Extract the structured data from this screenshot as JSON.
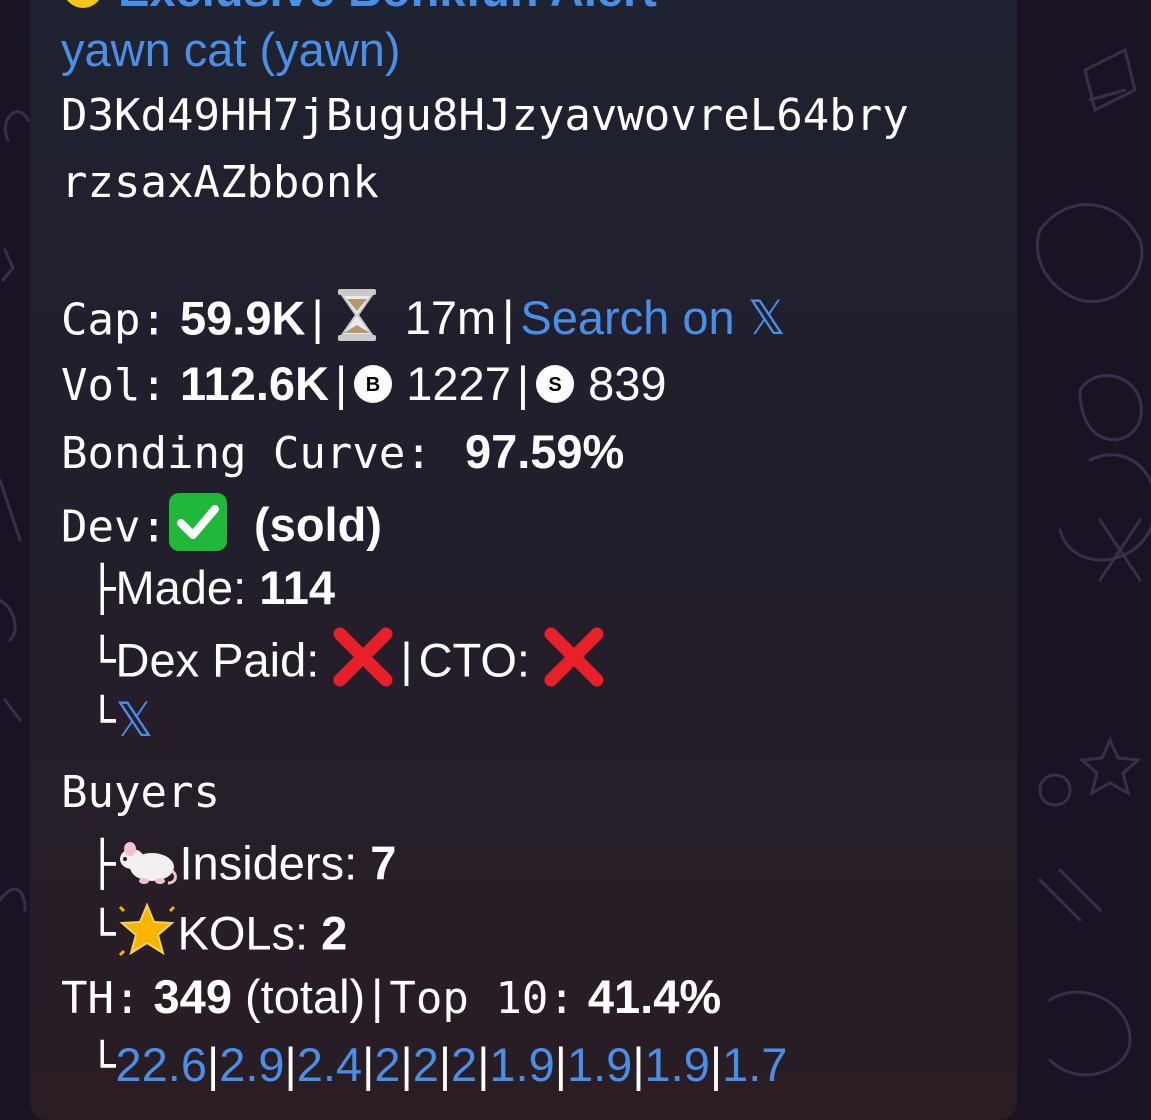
{
  "header": {
    "alert_title": "Exclusive Bonkfun Alert",
    "token_name": "yawn cat (yawn)",
    "address_line1": "D3Kd49HH7jBugu8HJzyavwovreL64bry",
    "address_line2": "rzsaxAZbbonk"
  },
  "stats": {
    "cap_label": "Cap:",
    "cap_value": "59.9K",
    "age_value": "17m",
    "search_label": "Search on",
    "vol_label": "Vol:",
    "vol_value": "112.6K",
    "buys_value": "1227",
    "sells_value": "839",
    "bonding_label": "Bonding Curve:",
    "bonding_value": "97.59%"
  },
  "dev": {
    "label": "Dev:",
    "status": "(sold)",
    "made_label": "Made:",
    "made_value": "114",
    "dex_paid_label": "Dex Paid:",
    "cto_label": "CTO:"
  },
  "buyers": {
    "label": "Buyers",
    "insiders_label": "Insiders:",
    "insiders_value": "7",
    "kols_label": "KOLs:",
    "kols_value": "2"
  },
  "holders": {
    "th_label": "TH:",
    "th_value": "349",
    "total_label": "(total)",
    "top10_label": "Top 10:",
    "top10_value": "41.4%",
    "percentages": [
      "22.6",
      "2.9",
      "2.4",
      "2",
      "2",
      "2",
      "1.9",
      "1.9",
      "1.9",
      "1.7"
    ]
  },
  "colors": {
    "link": "#4a8fe7",
    "bubble_top": "#1f2230",
    "bubble_bottom": "#2a1d24",
    "background": "#1a1324"
  }
}
